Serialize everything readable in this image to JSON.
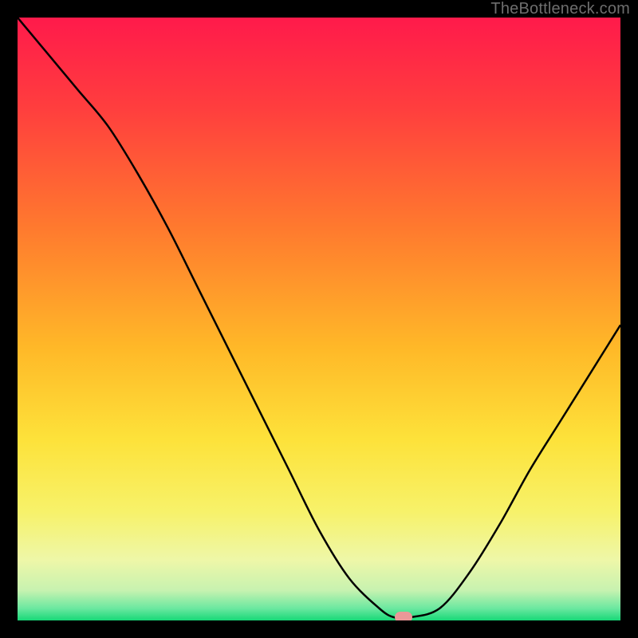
{
  "watermark": "TheBottleneck.com",
  "chart_data": {
    "type": "line",
    "title": "",
    "xlabel": "",
    "ylabel": "",
    "xlim": [
      0,
      100
    ],
    "ylim": [
      0,
      100
    ],
    "x": [
      0,
      5,
      10,
      15,
      20,
      25,
      30,
      35,
      40,
      45,
      50,
      55,
      60,
      62.5,
      65,
      70,
      75,
      80,
      85,
      90,
      95,
      100
    ],
    "values": [
      100,
      94,
      88,
      82,
      74,
      65,
      55,
      45,
      35,
      25,
      15,
      7,
      2,
      0.5,
      0.5,
      2,
      8,
      16,
      25,
      33,
      41,
      49
    ],
    "marker": {
      "x": 64,
      "y": 0.5
    },
    "gradient_stops": [
      {
        "offset": 0.0,
        "color": "#ff1a4b"
      },
      {
        "offset": 0.15,
        "color": "#ff3e3e"
      },
      {
        "offset": 0.35,
        "color": "#ff7a2e"
      },
      {
        "offset": 0.55,
        "color": "#ffb928"
      },
      {
        "offset": 0.7,
        "color": "#fde23a"
      },
      {
        "offset": 0.82,
        "color": "#f7f26a"
      },
      {
        "offset": 0.9,
        "color": "#eef7a8"
      },
      {
        "offset": 0.95,
        "color": "#c7f2b0"
      },
      {
        "offset": 0.98,
        "color": "#6be8a0"
      },
      {
        "offset": 1.0,
        "color": "#17d877"
      }
    ]
  }
}
